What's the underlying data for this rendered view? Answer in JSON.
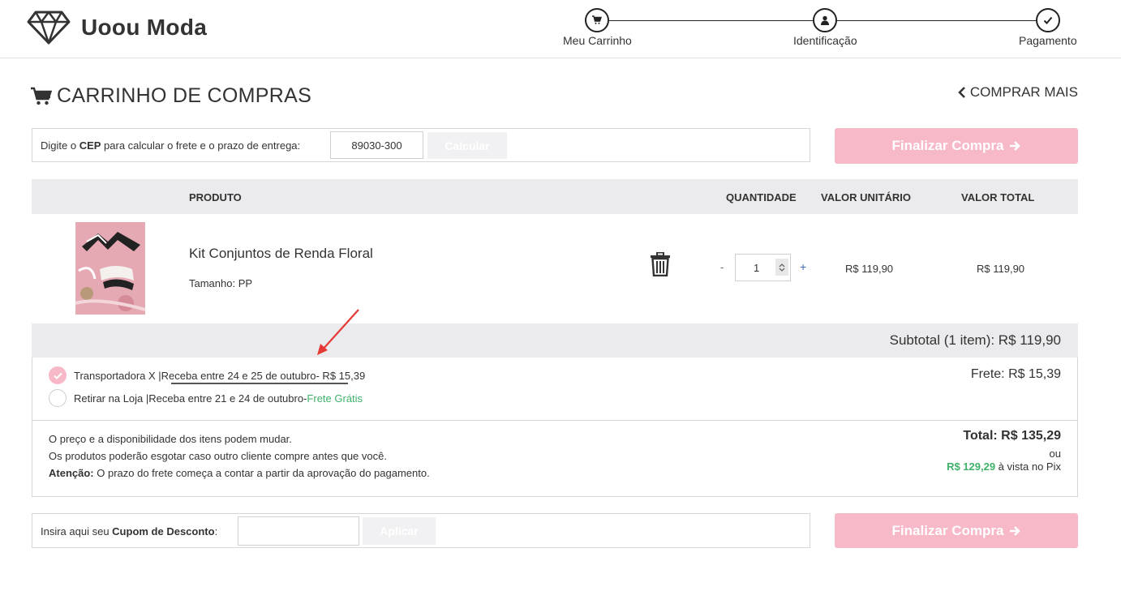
{
  "brand": {
    "name": "Uoou Moda",
    "logo_icon": "diamond-icon"
  },
  "steps": [
    {
      "label": "Meu Carrinho",
      "icon": "cart-icon"
    },
    {
      "label": "Identificação",
      "icon": "user-icon"
    },
    {
      "label": "Pagamento",
      "icon": "check-icon"
    }
  ],
  "page": {
    "title": "CARRINHO DE COMPRAS",
    "buy_more": "COMPRAR MAIS"
  },
  "cep": {
    "label_pre": "Digite o ",
    "label_bold": "CEP",
    "label_post": " para calcular o frete e o prazo de entrega:",
    "value": "89030-300",
    "button": "Calcular"
  },
  "finalize_label": "Finalizar Compra",
  "table": {
    "headers": {
      "product": "PRODUTO",
      "quantity": "QUANTIDADE",
      "unit_value": "VALOR UNITÁRIO",
      "total_value": "VALOR TOTAL"
    },
    "items": [
      {
        "name": "Kit Conjuntos de Renda Floral",
        "size": "Tamanho: PP",
        "quantity": "1",
        "minus": "-",
        "plus": "+",
        "unit_price": "R$ 119,90",
        "total_price": "R$ 119,90"
      }
    ]
  },
  "subtotal": "Subtotal (1 item): R$ 119,90",
  "shipping": {
    "options": [
      {
        "carrier": "Transportadora X | ",
        "window": "Receba entre 24 e 25 de outubro",
        "price": " - R$ 15,39",
        "selected": true
      },
      {
        "carrier": "Retirar na Loja | ",
        "window": "Receba entre 21 e 24 de outubro",
        "price_pre": " - ",
        "price": "Frete Grátis",
        "selected": false
      }
    ],
    "frete_summary": "Frete: R$ 15,39"
  },
  "notes": {
    "line1": "O preço e a disponibilidade dos itens podem mudar.",
    "line2": "Os produtos poderão esgotar caso outro cliente compre antes que você.",
    "attention_label": "Atenção:",
    "attention_text": " O prazo do frete começa a contar a partir da aprovação do pagamento."
  },
  "totals": {
    "total": "Total: R$ 135,29",
    "or": "ou",
    "pix_value": "R$ 129,29",
    "pix_text": " à vista no Pix"
  },
  "coupon": {
    "label_pre": "Insira aqui seu ",
    "label_bold": "Cupom de Desconto",
    "label_post": ":",
    "value": "",
    "button": "Aplicar"
  },
  "colors": {
    "accent_pink": "#f7b8c8",
    "free_green": "#3fb26a",
    "header_gray": "#ebebed",
    "annotation_red": "#e53935"
  }
}
